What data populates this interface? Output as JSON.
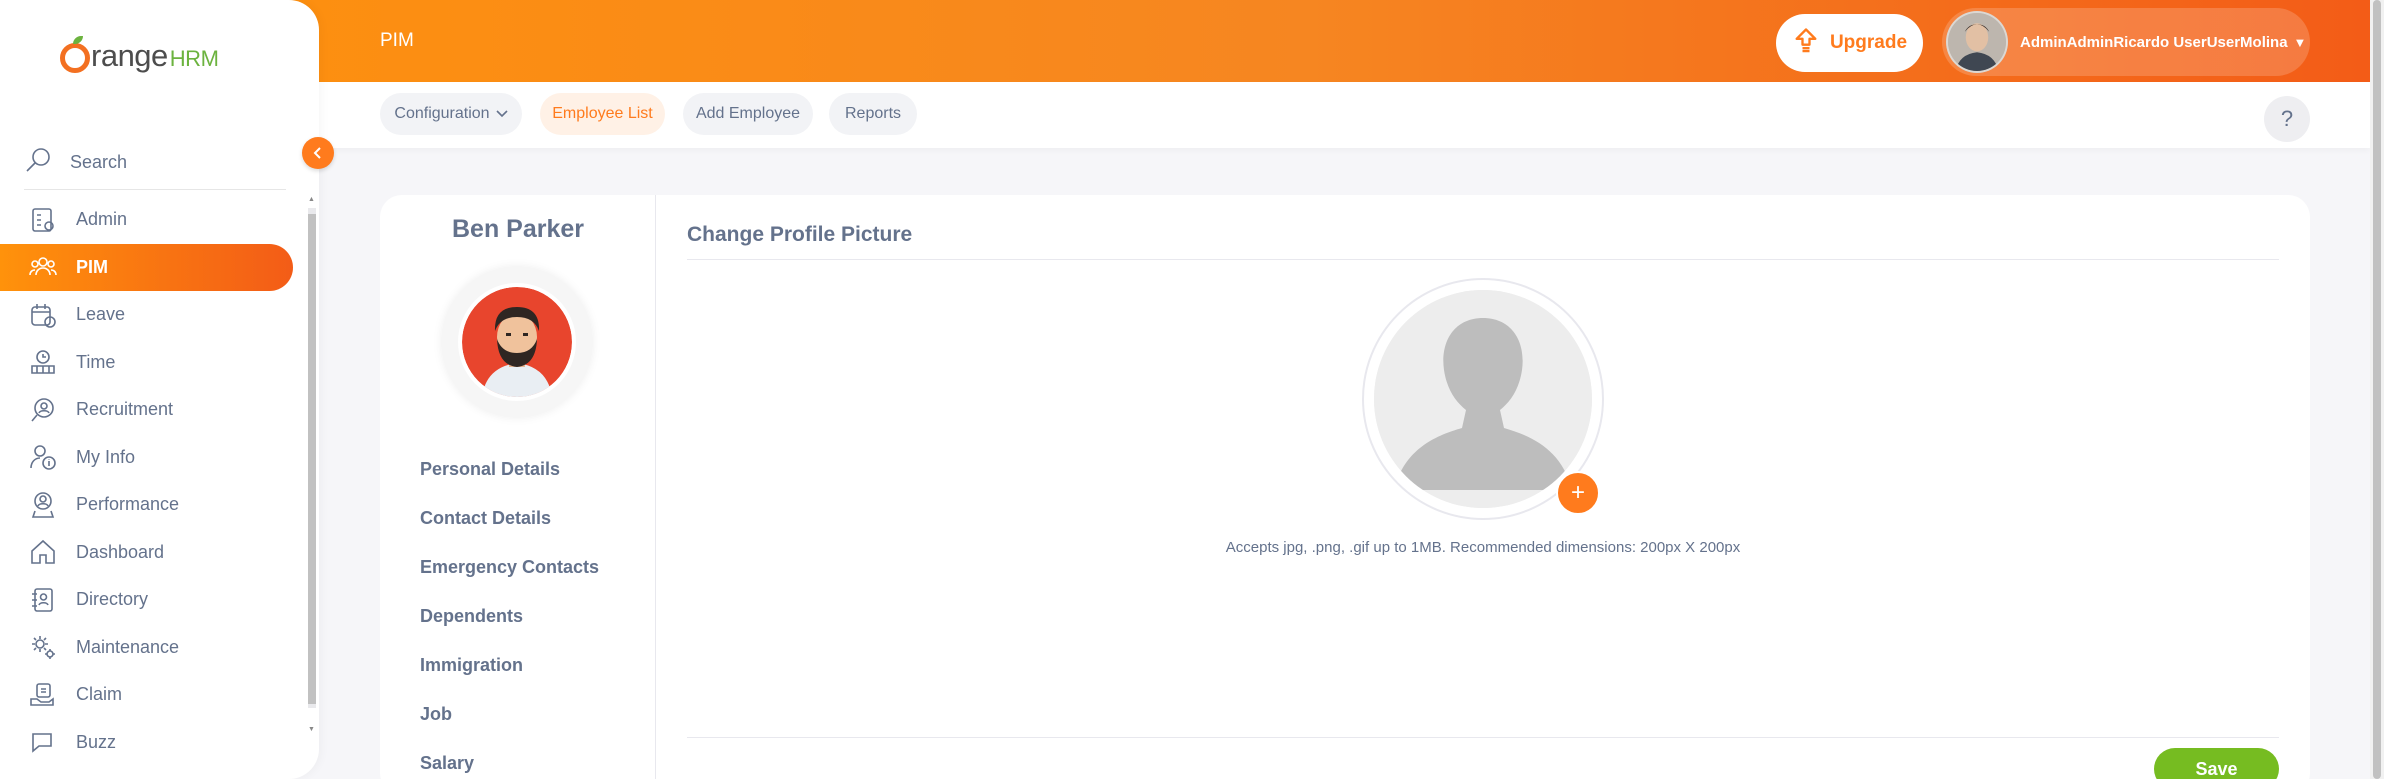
{
  "header": {
    "module_title": "PIM",
    "upgrade_label": "Upgrade",
    "user_name": "AdminAdminRicardo UserUserMolina",
    "help_label": "?"
  },
  "subnav": {
    "tabs": [
      {
        "label": "Configuration",
        "has_dropdown": true,
        "active": false
      },
      {
        "label": "Employee List",
        "active": true
      },
      {
        "label": "Add Employee",
        "active": false
      },
      {
        "label": "Reports",
        "active": false
      }
    ]
  },
  "sidebar": {
    "brand": {
      "part1": "range",
      "part2": "HRM"
    },
    "search_label": "Search",
    "items": [
      {
        "label": "Admin",
        "icon": "admin-icon"
      },
      {
        "label": "PIM",
        "icon": "pim-icon",
        "active": true
      },
      {
        "label": "Leave",
        "icon": "leave-icon"
      },
      {
        "label": "Time",
        "icon": "time-icon"
      },
      {
        "label": "Recruitment",
        "icon": "recruitment-icon"
      },
      {
        "label": "My Info",
        "icon": "my-info-icon"
      },
      {
        "label": "Performance",
        "icon": "performance-icon"
      },
      {
        "label": "Dashboard",
        "icon": "dashboard-icon"
      },
      {
        "label": "Directory",
        "icon": "directory-icon"
      },
      {
        "label": "Maintenance",
        "icon": "maintenance-icon"
      },
      {
        "label": "Claim",
        "icon": "claim-icon"
      },
      {
        "label": "Buzz",
        "icon": "buzz-icon"
      }
    ]
  },
  "employee": {
    "name": "Ben Parker",
    "tabs": [
      "Personal Details",
      "Contact Details",
      "Emergency Contacts",
      "Dependents",
      "Immigration",
      "Job",
      "Salary"
    ]
  },
  "profile_picture": {
    "title": "Change Profile Picture",
    "add_label": "+",
    "hint": "Accepts jpg, .png, .gif up to 1MB. Recommended dimensions: 200px X 200px",
    "save_label": "Save"
  },
  "colors": {
    "accent": "#ff7b1d",
    "save": "#76bc21"
  }
}
